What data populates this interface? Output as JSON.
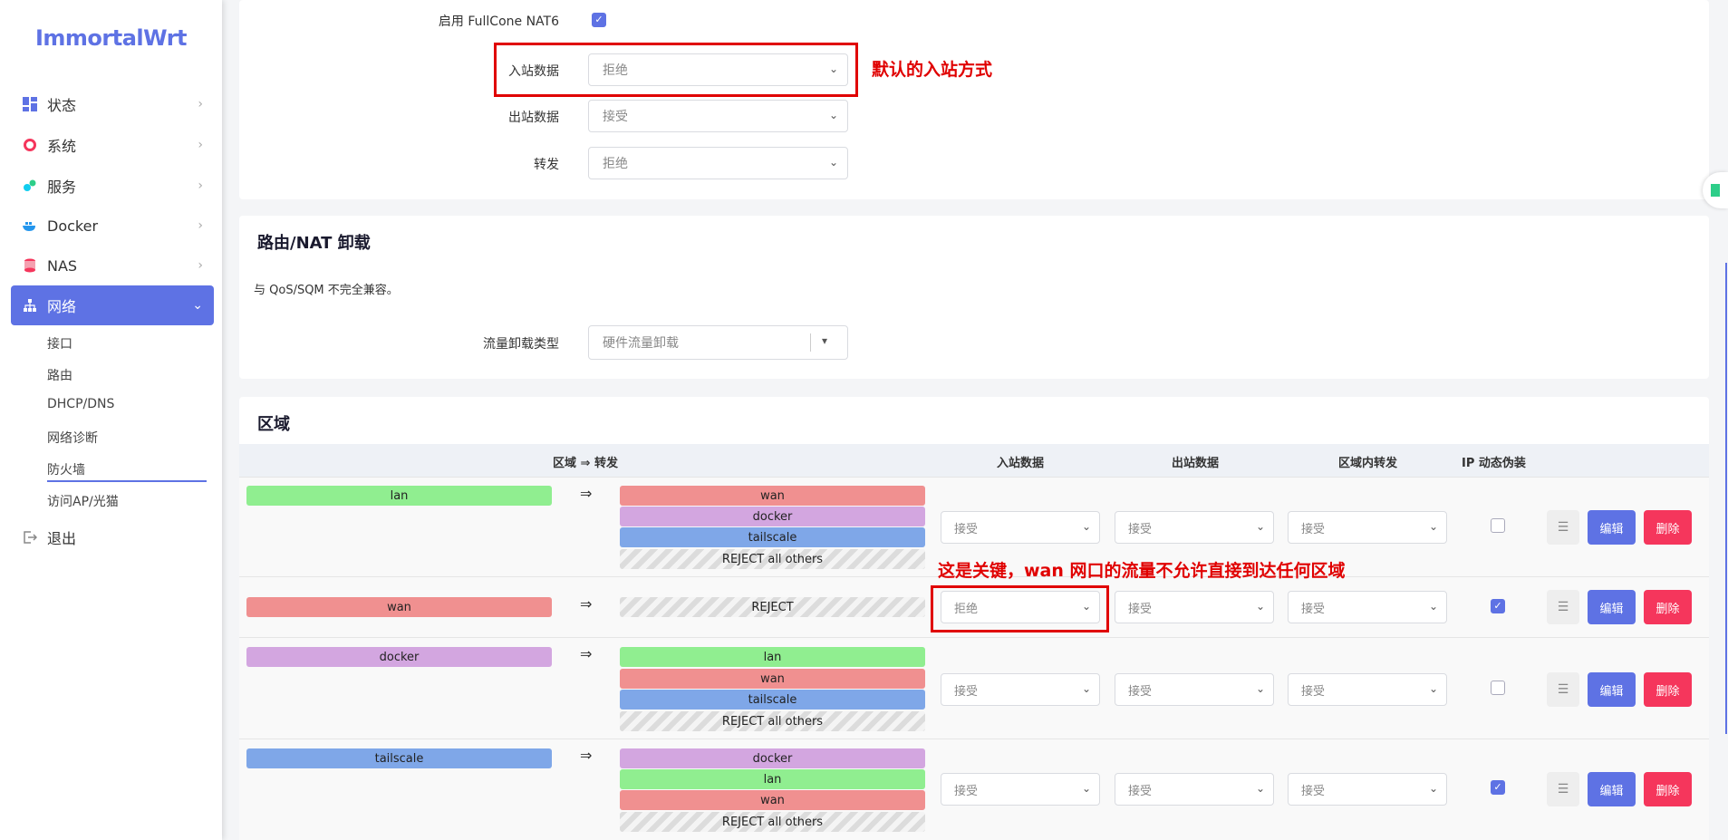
{
  "sidebar": {
    "logo": "ImmortalWrt",
    "menu": [
      {
        "label": "状态",
        "icon": "dashboard-icon",
        "color": "#5e72e4"
      },
      {
        "label": "系统",
        "icon": "gear-icon",
        "color": "#f5365c"
      },
      {
        "label": "服务",
        "icon": "puzzle-icon",
        "color": "#11cdef"
      },
      {
        "label": "Docker",
        "icon": "docker-icon",
        "color": "#2496ed"
      },
      {
        "label": "NAS",
        "icon": "database-icon",
        "color": "#f5365c"
      },
      {
        "label": "网络",
        "icon": "network-icon",
        "color": "#ffffff"
      }
    ],
    "submenu": [
      "接口",
      "路由",
      "DHCP/DNS",
      "网络诊断",
      "防火墙",
      "访问AP/光猫"
    ],
    "logout": "退出"
  },
  "general": {
    "fullcone_label": "启用 FullCone NAT6",
    "input_label": "入站数据",
    "input_value": "拒绝",
    "output_label": "出站数据",
    "output_value": "接受",
    "forward_label": "转发",
    "forward_value": "拒绝"
  },
  "offload": {
    "title": "路由/NAT 卸载",
    "desc": "与 QoS/SQM 不完全兼容。",
    "type_label": "流量卸载类型",
    "type_value": "硬件流量卸载"
  },
  "zones": {
    "title": "区域",
    "headers": {
      "zone_forward": "区域 ⇒ 转发",
      "input": "入站数据",
      "output": "出站数据",
      "intra": "区域内转发",
      "masq": "IP 动态伪装"
    },
    "arrow": "⇒",
    "edit_label": "编辑",
    "delete_label": "删除",
    "rows": [
      {
        "zone": "lan",
        "targets": [
          "wan",
          "docker",
          "tailscale",
          "REJECT all others"
        ],
        "input": "接受",
        "output": "接受",
        "intra": "接受",
        "masq": false
      },
      {
        "zone": "wan",
        "targets": [
          "REJECT"
        ],
        "input": "拒绝",
        "output": "接受",
        "intra": "接受",
        "masq": true
      },
      {
        "zone": "docker",
        "targets": [
          "lan",
          "wan",
          "tailscale",
          "REJECT all others"
        ],
        "input": "接受",
        "output": "接受",
        "intra": "接受",
        "masq": false
      },
      {
        "zone": "tailscale",
        "targets": [
          "docker",
          "lan",
          "wan",
          "REJECT all others"
        ],
        "input": "接受",
        "output": "接受",
        "intra": "接受",
        "masq": true
      }
    ]
  },
  "annotations": {
    "default_input": "默认的入站方式",
    "wan_note": "这是关键，wan 网口的流量不允许直接到达任何区域"
  }
}
